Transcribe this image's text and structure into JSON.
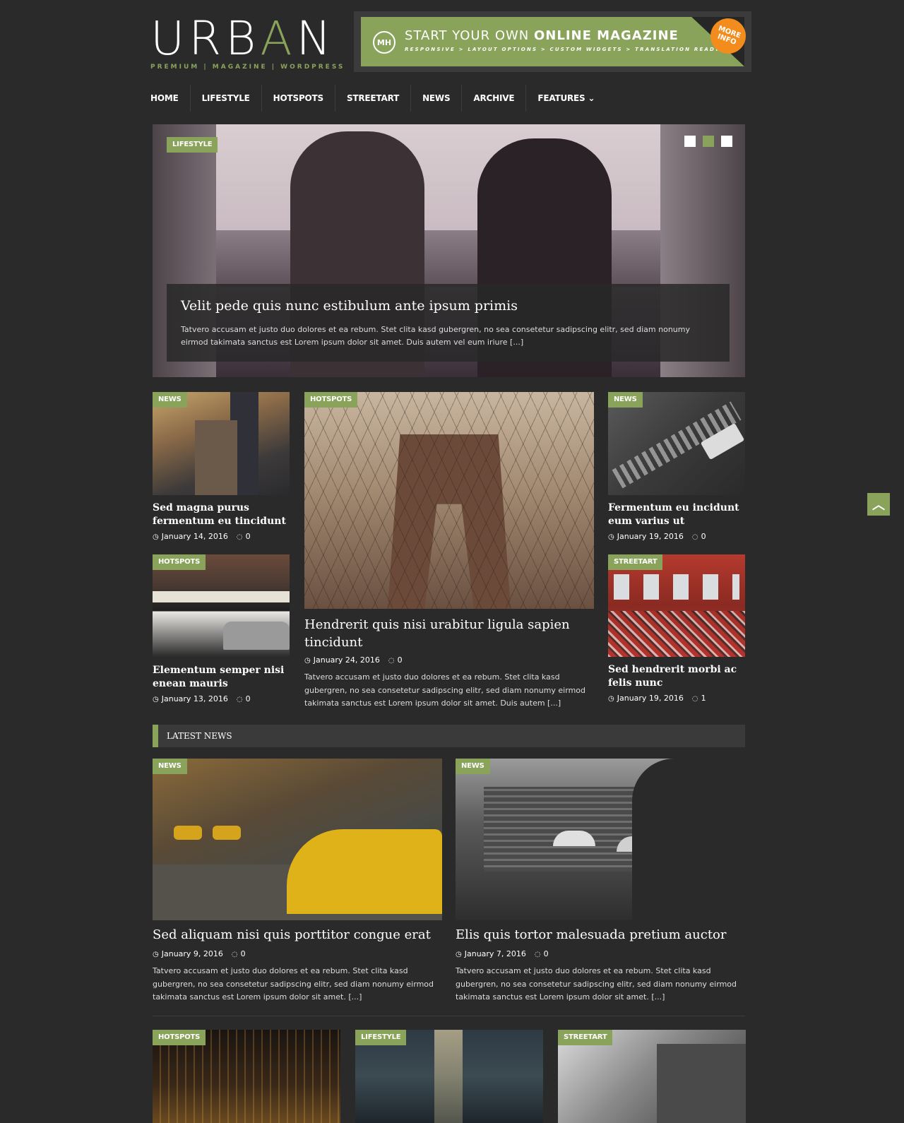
{
  "logo": {
    "main_pre": "URB",
    "main_acc": "A",
    "main_post": "N",
    "tagline": "PREMIUM | MAGAZINE | WORDPRESS"
  },
  "banner": {
    "badge": "MH",
    "title_light": "START YOUR OWN",
    "title_bold": "ONLINE MAGAZINE",
    "subtitle": "RESPONSIVE > LAYOUT OPTIONS > CUSTOM WIDGETS > TRANSLATION READY",
    "more": "MORE INFO"
  },
  "nav": [
    "HOME",
    "LIFESTYLE",
    "HOTSPOTS",
    "STREETART",
    "NEWS",
    "ARCHIVE",
    "FEATURES ⌄"
  ],
  "hero": {
    "tag": "LIFESTYLE",
    "title": "Velit pede quis nunc estibulum ante ipsum primis",
    "excerpt": "Tatvero accusam et justo duo dolores et ea rebum. Stet clita kasd gubergren, no sea consetetur sadipscing elitr, sed diam nonumy eirmod takimata sanctus est Lorem ipsum dolor sit amet. Duis autem vel eum iriure [...]"
  },
  "grid": {
    "card1": {
      "tag": "NEWS",
      "title": "Sed magna purus fermentum eu tincidunt",
      "date": "January 14, 2016",
      "comments": "0"
    },
    "card2": {
      "tag": "HOTSPOTS",
      "title": "Elementum semper nisi enean mauris",
      "date": "January 13, 2016",
      "comments": "0"
    },
    "featured": {
      "tag": "HOTSPOTS",
      "title": "Hendrerit quis nisi urabitur ligula sapien tincidunt",
      "date": "January 24, 2016",
      "comments": "0",
      "excerpt": "Tatvero accusam et justo duo dolores et ea rebum. Stet clita kasd gubergren, no sea consetetur sadipscing elitr, sed diam nonumy eirmod takimata sanctus est Lorem ipsum dolor sit amet. Duis autem [...]"
    },
    "card3": {
      "tag": "NEWS",
      "title": "Fermentum eu incidunt eum varius ut",
      "date": "January 19, 2016",
      "comments": "0"
    },
    "card4": {
      "tag": "STREETART",
      "title": "Sed hendrerit morbi ac felis nunc",
      "date": "January 19, 2016",
      "comments": "1"
    }
  },
  "latest": {
    "heading": "LATEST NEWS",
    "post1": {
      "tag": "NEWS",
      "title": "Sed aliquam nisi quis porttitor congue erat",
      "date": "January 9, 2016",
      "comments": "0",
      "excerpt": "Tatvero accusam et justo duo dolores et ea rebum. Stet clita kasd gubergren, no sea consetetur sadipscing elitr, sed diam nonumy eirmod takimata sanctus est Lorem ipsum dolor sit amet. [...]"
    },
    "post2": {
      "tag": "NEWS",
      "title": "Elis quis tortor malesuada pretium auctor",
      "date": "January 7, 2016",
      "comments": "0",
      "excerpt": "Tatvero accusam et justo duo dolores et ea rebum. Stet clita kasd gubergren, no sea consetetur sadipscing elitr, sed diam nonumy eirmod takimata sanctus est Lorem ipsum dolor sit amet. [...]"
    }
  },
  "bottom_tags": [
    "HOTSPOTS",
    "LIFESTYLE",
    "STREETART"
  ],
  "icons": {
    "clock": "clock-icon",
    "comment": "comment-icon",
    "scroll_top": "chevron-up-icon"
  },
  "colors": {
    "accent": "#8aa35a",
    "background": "#2a2a2a",
    "badge": "#f28c1c"
  }
}
